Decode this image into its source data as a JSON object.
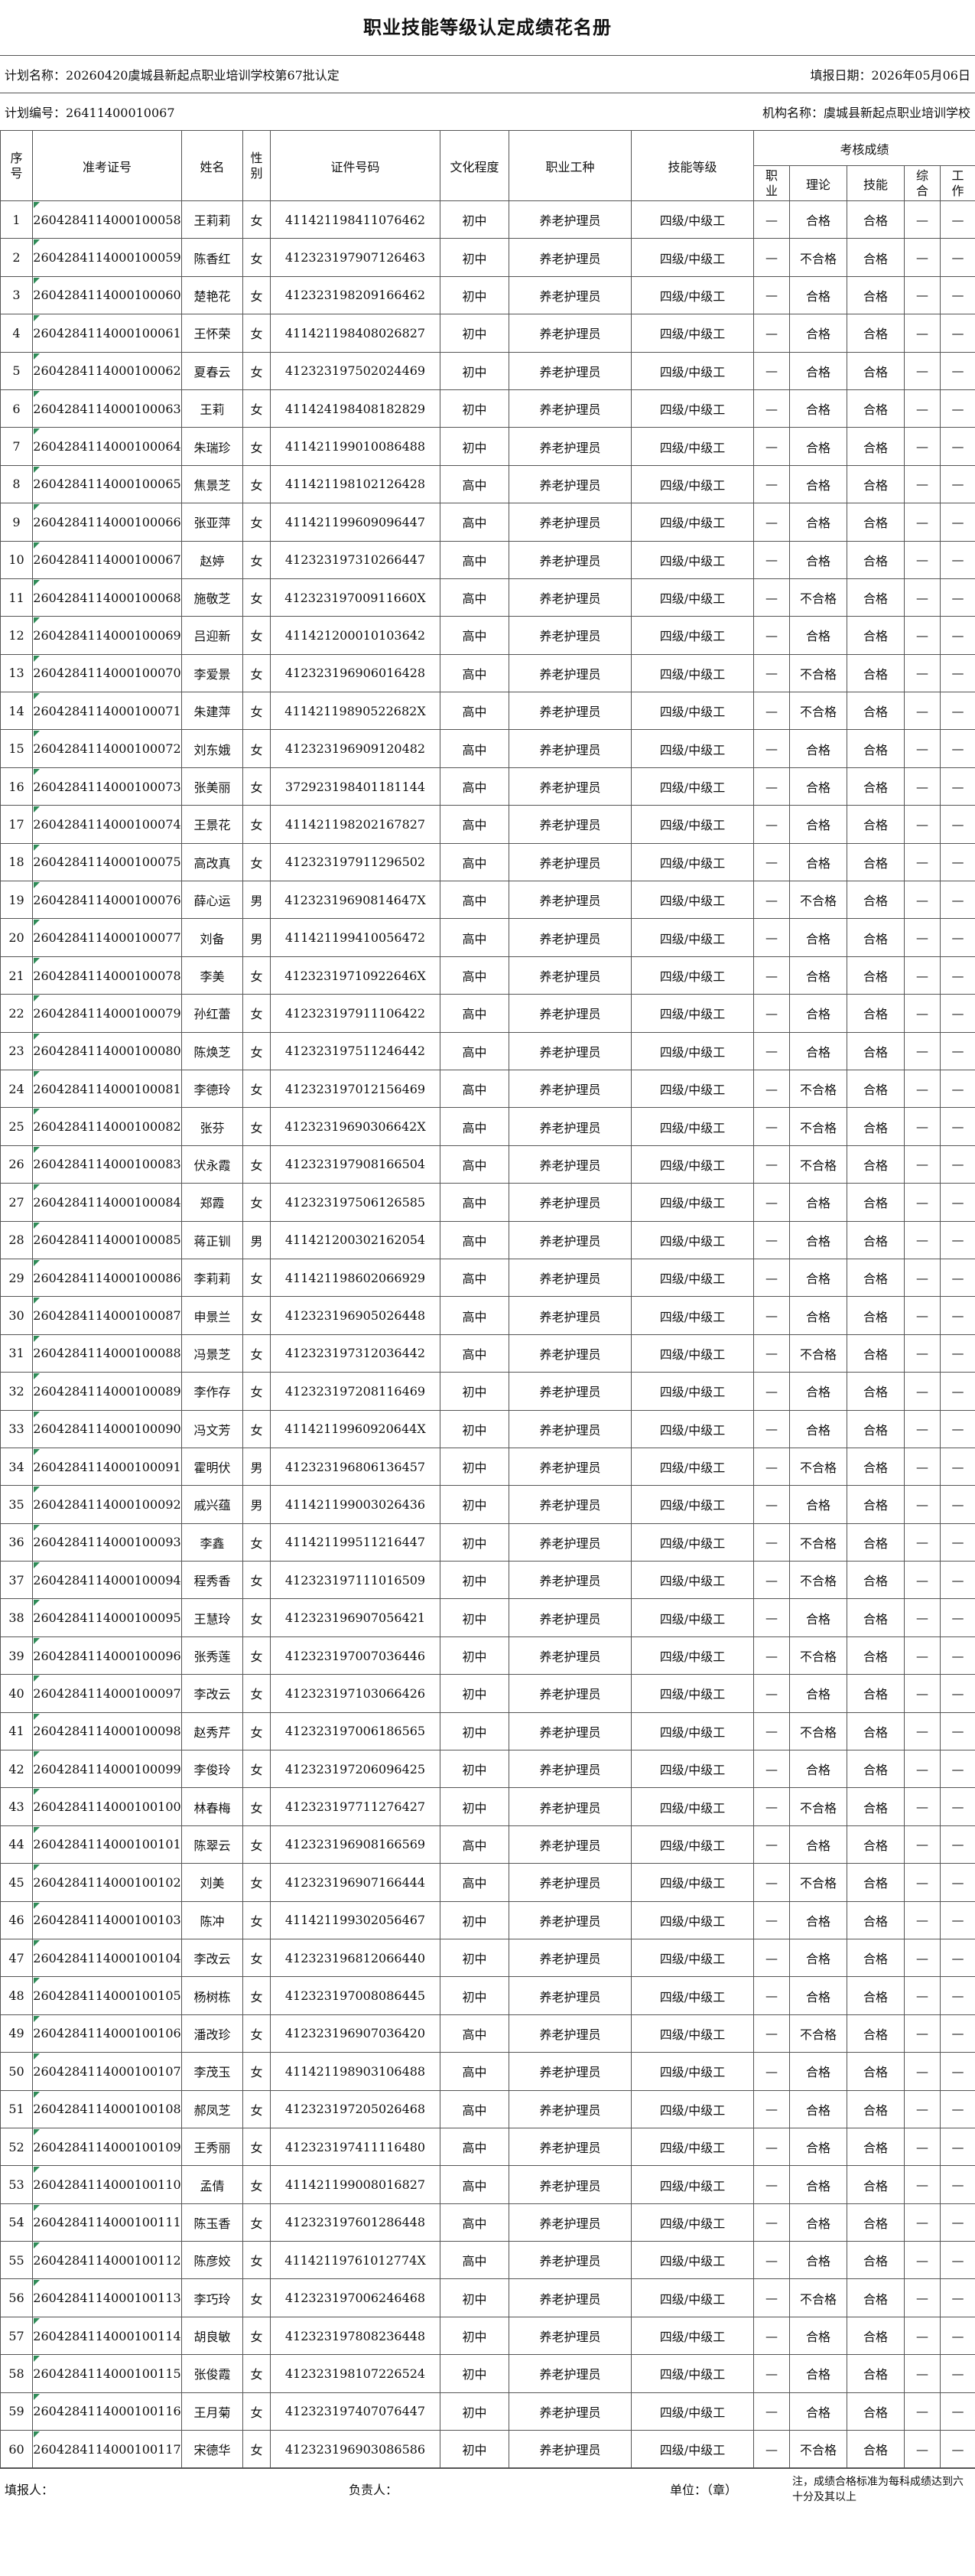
{
  "header": {
    "title": "职业技能等级认定成绩花名册",
    "plan_name": "计划名称：20260420虞城县新起点职业培训学校第67批认定",
    "report_date": "填报日期：2026年05月06日",
    "plan_code": "计划编号：26411400010067",
    "org_name": "机构名称：虞城县新起点职业培训学校"
  },
  "columns": {
    "seq": "序号",
    "ticket": "准考证号",
    "name": "姓名",
    "gender": "性别",
    "id": "证件号码",
    "edu": "文化程度",
    "trade": "职业工种",
    "level": "技能等级",
    "scores": "考核成绩",
    "score_cols": [
      "职业",
      "理论",
      "技能",
      "综合",
      "工作"
    ]
  },
  "rows": [
    [
      "1",
      "2604284114000100058",
      "王莉莉",
      "女",
      "411421198411076462",
      "初中",
      "养老护理员",
      "四级/中级工",
      "—",
      "合格",
      "合格",
      "—",
      "—"
    ],
    [
      "2",
      "2604284114000100059",
      "陈香红",
      "女",
      "412323197907126463",
      "初中",
      "养老护理员",
      "四级/中级工",
      "—",
      "不合格",
      "合格",
      "—",
      "—"
    ],
    [
      "3",
      "2604284114000100060",
      "楚艳花",
      "女",
      "412323198209166462",
      "初中",
      "养老护理员",
      "四级/中级工",
      "—",
      "合格",
      "合格",
      "—",
      "—"
    ],
    [
      "4",
      "2604284114000100061",
      "王怀荣",
      "女",
      "411421198408026827",
      "初中",
      "养老护理员",
      "四级/中级工",
      "—",
      "合格",
      "合格",
      "—",
      "—"
    ],
    [
      "5",
      "2604284114000100062",
      "夏春云",
      "女",
      "412323197502024469",
      "初中",
      "养老护理员",
      "四级/中级工",
      "—",
      "合格",
      "合格",
      "—",
      "—"
    ],
    [
      "6",
      "2604284114000100063",
      "王莉",
      "女",
      "411424198408182829",
      "初中",
      "养老护理员",
      "四级/中级工",
      "—",
      "合格",
      "合格",
      "—",
      "—"
    ],
    [
      "7",
      "2604284114000100064",
      "朱瑞珍",
      "女",
      "411421199010086488",
      "初中",
      "养老护理员",
      "四级/中级工",
      "—",
      "合格",
      "合格",
      "—",
      "—"
    ],
    [
      "8",
      "2604284114000100065",
      "焦景芝",
      "女",
      "411421198102126428",
      "高中",
      "养老护理员",
      "四级/中级工",
      "—",
      "合格",
      "合格",
      "—",
      "—"
    ],
    [
      "9",
      "2604284114000100066",
      "张亚萍",
      "女",
      "411421199609096447",
      "高中",
      "养老护理员",
      "四级/中级工",
      "—",
      "合格",
      "合格",
      "—",
      "—"
    ],
    [
      "10",
      "2604284114000100067",
      "赵婷",
      "女",
      "412323197310266447",
      "高中",
      "养老护理员",
      "四级/中级工",
      "—",
      "合格",
      "合格",
      "—",
      "—"
    ],
    [
      "11",
      "2604284114000100068",
      "施敬芝",
      "女",
      "41232319700911660X",
      "高中",
      "养老护理员",
      "四级/中级工",
      "—",
      "不合格",
      "合格",
      "—",
      "—"
    ],
    [
      "12",
      "2604284114000100069",
      "吕迎新",
      "女",
      "411421200010103642",
      "高中",
      "养老护理员",
      "四级/中级工",
      "—",
      "合格",
      "合格",
      "—",
      "—"
    ],
    [
      "13",
      "2604284114000100070",
      "李爱景",
      "女",
      "412323196906016428",
      "高中",
      "养老护理员",
      "四级/中级工",
      "—",
      "不合格",
      "合格",
      "—",
      "—"
    ],
    [
      "14",
      "2604284114000100071",
      "朱建萍",
      "女",
      "41142119890522682X",
      "高中",
      "养老护理员",
      "四级/中级工",
      "—",
      "不合格",
      "合格",
      "—",
      "—"
    ],
    [
      "15",
      "2604284114000100072",
      "刘东娥",
      "女",
      "412323196909120482",
      "高中",
      "养老护理员",
      "四级/中级工",
      "—",
      "合格",
      "合格",
      "—",
      "—"
    ],
    [
      "16",
      "2604284114000100073",
      "张美丽",
      "女",
      "372923198401181144",
      "高中",
      "养老护理员",
      "四级/中级工",
      "—",
      "合格",
      "合格",
      "—",
      "—"
    ],
    [
      "17",
      "2604284114000100074",
      "王景花",
      "女",
      "411421198202167827",
      "高中",
      "养老护理员",
      "四级/中级工",
      "—",
      "合格",
      "合格",
      "—",
      "—"
    ],
    [
      "18",
      "2604284114000100075",
      "高改真",
      "女",
      "412323197911296502",
      "高中",
      "养老护理员",
      "四级/中级工",
      "—",
      "合格",
      "合格",
      "—",
      "—"
    ],
    [
      "19",
      "2604284114000100076",
      "薛心运",
      "男",
      "41232319690814647X",
      "高中",
      "养老护理员",
      "四级/中级工",
      "—",
      "不合格",
      "合格",
      "—",
      "—"
    ],
    [
      "20",
      "2604284114000100077",
      "刘备",
      "男",
      "411421199410056472",
      "高中",
      "养老护理员",
      "四级/中级工",
      "—",
      "合格",
      "合格",
      "—",
      "—"
    ],
    [
      "21",
      "2604284114000100078",
      "李美",
      "女",
      "41232319710922646X",
      "高中",
      "养老护理员",
      "四级/中级工",
      "—",
      "合格",
      "合格",
      "—",
      "—"
    ],
    [
      "22",
      "2604284114000100079",
      "孙红蕾",
      "女",
      "412323197911106422",
      "高中",
      "养老护理员",
      "四级/中级工",
      "—",
      "合格",
      "合格",
      "—",
      "—"
    ],
    [
      "23",
      "2604284114000100080",
      "陈焕芝",
      "女",
      "412323197511246442",
      "高中",
      "养老护理员",
      "四级/中级工",
      "—",
      "合格",
      "合格",
      "—",
      "—"
    ],
    [
      "24",
      "2604284114000100081",
      "李德玲",
      "女",
      "412323197012156469",
      "高中",
      "养老护理员",
      "四级/中级工",
      "—",
      "不合格",
      "合格",
      "—",
      "—"
    ],
    [
      "25",
      "2604284114000100082",
      "张芬",
      "女",
      "41232319690306642X",
      "高中",
      "养老护理员",
      "四级/中级工",
      "—",
      "不合格",
      "合格",
      "—",
      "—"
    ],
    [
      "26",
      "2604284114000100083",
      "伏永霞",
      "女",
      "412323197908166504",
      "高中",
      "养老护理员",
      "四级/中级工",
      "—",
      "不合格",
      "合格",
      "—",
      "—"
    ],
    [
      "27",
      "2604284114000100084",
      "郑霞",
      "女",
      "412323197506126585",
      "高中",
      "养老护理员",
      "四级/中级工",
      "—",
      "合格",
      "合格",
      "—",
      "—"
    ],
    [
      "28",
      "2604284114000100085",
      "蒋正钏",
      "男",
      "411421200302162054",
      "高中",
      "养老护理员",
      "四级/中级工",
      "—",
      "合格",
      "合格",
      "—",
      "—"
    ],
    [
      "29",
      "2604284114000100086",
      "李莉莉",
      "女",
      "411421198602066929",
      "高中",
      "养老护理员",
      "四级/中级工",
      "—",
      "合格",
      "合格",
      "—",
      "—"
    ],
    [
      "30",
      "2604284114000100087",
      "申景兰",
      "女",
      "412323196905026448",
      "高中",
      "养老护理员",
      "四级/中级工",
      "—",
      "合格",
      "合格",
      "—",
      "—"
    ],
    [
      "31",
      "2604284114000100088",
      "冯景芝",
      "女",
      "412323197312036442",
      "高中",
      "养老护理员",
      "四级/中级工",
      "—",
      "不合格",
      "合格",
      "—",
      "—"
    ],
    [
      "32",
      "2604284114000100089",
      "李作存",
      "女",
      "412323197208116469",
      "初中",
      "养老护理员",
      "四级/中级工",
      "—",
      "合格",
      "合格",
      "—",
      "—"
    ],
    [
      "33",
      "2604284114000100090",
      "冯文芳",
      "女",
      "41142119960920644X",
      "初中",
      "养老护理员",
      "四级/中级工",
      "—",
      "合格",
      "合格",
      "—",
      "—"
    ],
    [
      "34",
      "2604284114000100091",
      "霍明伏",
      "男",
      "412323196806136457",
      "初中",
      "养老护理员",
      "四级/中级工",
      "—",
      "不合格",
      "合格",
      "—",
      "—"
    ],
    [
      "35",
      "2604284114000100092",
      "戚兴蕴",
      "男",
      "411421199003026436",
      "初中",
      "养老护理员",
      "四级/中级工",
      "—",
      "合格",
      "合格",
      "—",
      "—"
    ],
    [
      "36",
      "2604284114000100093",
      "李鑫",
      "女",
      "411421199511216447",
      "初中",
      "养老护理员",
      "四级/中级工",
      "—",
      "不合格",
      "合格",
      "—",
      "—"
    ],
    [
      "37",
      "2604284114000100094",
      "程秀香",
      "女",
      "412323197111016509",
      "初中",
      "养老护理员",
      "四级/中级工",
      "—",
      "不合格",
      "合格",
      "—",
      "—"
    ],
    [
      "38",
      "2604284114000100095",
      "王慧玲",
      "女",
      "412323196907056421",
      "初中",
      "养老护理员",
      "四级/中级工",
      "—",
      "合格",
      "合格",
      "—",
      "—"
    ],
    [
      "39",
      "2604284114000100096",
      "张秀莲",
      "女",
      "412323197007036446",
      "初中",
      "养老护理员",
      "四级/中级工",
      "—",
      "不合格",
      "合格",
      "—",
      "—"
    ],
    [
      "40",
      "2604284114000100097",
      "李改云",
      "女",
      "412323197103066426",
      "初中",
      "养老护理员",
      "四级/中级工",
      "—",
      "合格",
      "合格",
      "—",
      "—"
    ],
    [
      "41",
      "2604284114000100098",
      "赵秀芹",
      "女",
      "412323197006186565",
      "初中",
      "养老护理员",
      "四级/中级工",
      "—",
      "不合格",
      "合格",
      "—",
      "—"
    ],
    [
      "42",
      "2604284114000100099",
      "李俊玲",
      "女",
      "412323197206096425",
      "初中",
      "养老护理员",
      "四级/中级工",
      "—",
      "合格",
      "合格",
      "—",
      "—"
    ],
    [
      "43",
      "2604284114000100100",
      "林春梅",
      "女",
      "412323197711276427",
      "初中",
      "养老护理员",
      "四级/中级工",
      "—",
      "不合格",
      "合格",
      "—",
      "—"
    ],
    [
      "44",
      "2604284114000100101",
      "陈翠云",
      "女",
      "412323196908166569",
      "高中",
      "养老护理员",
      "四级/中级工",
      "—",
      "合格",
      "合格",
      "—",
      "—"
    ],
    [
      "45",
      "2604284114000100102",
      "刘美",
      "女",
      "412323196907166444",
      "高中",
      "养老护理员",
      "四级/中级工",
      "—",
      "不合格",
      "合格",
      "—",
      "—"
    ],
    [
      "46",
      "2604284114000100103",
      "陈冲",
      "女",
      "411421199302056467",
      "初中",
      "养老护理员",
      "四级/中级工",
      "—",
      "合格",
      "合格",
      "—",
      "—"
    ],
    [
      "47",
      "2604284114000100104",
      "李改云",
      "女",
      "412323196812066440",
      "初中",
      "养老护理员",
      "四级/中级工",
      "—",
      "合格",
      "合格",
      "—",
      "—"
    ],
    [
      "48",
      "2604284114000100105",
      "杨树栋",
      "女",
      "412323197008086445",
      "初中",
      "养老护理员",
      "四级/中级工",
      "—",
      "合格",
      "合格",
      "—",
      "—"
    ],
    [
      "49",
      "2604284114000100106",
      "潘改珍",
      "女",
      "412323196907036420",
      "高中",
      "养老护理员",
      "四级/中级工",
      "—",
      "不合格",
      "合格",
      "—",
      "—"
    ],
    [
      "50",
      "2604284114000100107",
      "李茂玉",
      "女",
      "411421198903106488",
      "高中",
      "养老护理员",
      "四级/中级工",
      "—",
      "合格",
      "合格",
      "—",
      "—"
    ],
    [
      "51",
      "2604284114000100108",
      "郝凤芝",
      "女",
      "412323197205026468",
      "高中",
      "养老护理员",
      "四级/中级工",
      "—",
      "合格",
      "合格",
      "—",
      "—"
    ],
    [
      "52",
      "2604284114000100109",
      "王秀丽",
      "女",
      "412323197411116480",
      "高中",
      "养老护理员",
      "四级/中级工",
      "—",
      "合格",
      "合格",
      "—",
      "—"
    ],
    [
      "53",
      "2604284114000100110",
      "孟倩",
      "女",
      "411421199008016827",
      "高中",
      "养老护理员",
      "四级/中级工",
      "—",
      "合格",
      "合格",
      "—",
      "—"
    ],
    [
      "54",
      "2604284114000100111",
      "陈玉香",
      "女",
      "412323197601286448",
      "高中",
      "养老护理员",
      "四级/中级工",
      "—",
      "合格",
      "合格",
      "—",
      "—"
    ],
    [
      "55",
      "2604284114000100112",
      "陈彦姣",
      "女",
      "41142119761012774X",
      "高中",
      "养老护理员",
      "四级/中级工",
      "—",
      "合格",
      "合格",
      "—",
      "—"
    ],
    [
      "56",
      "2604284114000100113",
      "李巧玲",
      "女",
      "412323197006246468",
      "初中",
      "养老护理员",
      "四级/中级工",
      "—",
      "不合格",
      "合格",
      "—",
      "—"
    ],
    [
      "57",
      "2604284114000100114",
      "胡良敏",
      "女",
      "412323197808236448",
      "初中",
      "养老护理员",
      "四级/中级工",
      "—",
      "合格",
      "合格",
      "—",
      "—"
    ],
    [
      "58",
      "2604284114000100115",
      "张俊霞",
      "女",
      "412323198107226524",
      "初中",
      "养老护理员",
      "四级/中级工",
      "—",
      "合格",
      "合格",
      "—",
      "—"
    ],
    [
      "59",
      "2604284114000100116",
      "王月菊",
      "女",
      "412323197407076447",
      "初中",
      "养老护理员",
      "四级/中级工",
      "—",
      "合格",
      "合格",
      "—",
      "—"
    ],
    [
      "60",
      "2604284114000100117",
      "宋德华",
      "女",
      "412323196903086586",
      "初中",
      "养老护理员",
      "四级/中级工",
      "—",
      "不合格",
      "合格",
      "—",
      "—"
    ]
  ],
  "footer": {
    "filler": "填报人：",
    "responsible": "负责人：",
    "unit": "单位：（章）",
    "note": "注，成绩合格标准为每科成绩达到六十分及其以上"
  }
}
